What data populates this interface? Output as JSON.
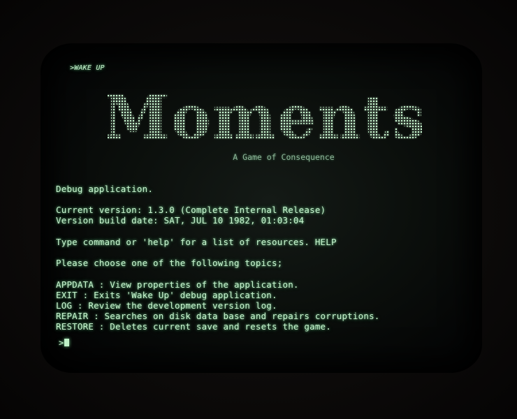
{
  "terminal": {
    "top_command": ">WAKE UP",
    "logo_text": "Moments",
    "subtitle": "A Game of Consequence",
    "lines": [
      "Debug application.",
      "Current version: 1.3.0 (Complete Internal Release)",
      "Version build date: SAT, JUL 10 1982, 01:03:04",
      "Type command or 'help' for a list of resources. HELP",
      "Please choose one of the following topics;",
      "APPDATA : View properties of the application.",
      "EXIT : Exits 'Wake Up' debug application.",
      "LOG : Review the development version log.",
      "REPAIR : Searches on disk data base and repairs corruptions.",
      "RESTORE : Deletes current save and resets the game."
    ],
    "prompt": ">"
  },
  "colors": {
    "phosphor": "#c8f5cf",
    "subtitle": "#8fb79a",
    "background": "#0b0f0c"
  }
}
